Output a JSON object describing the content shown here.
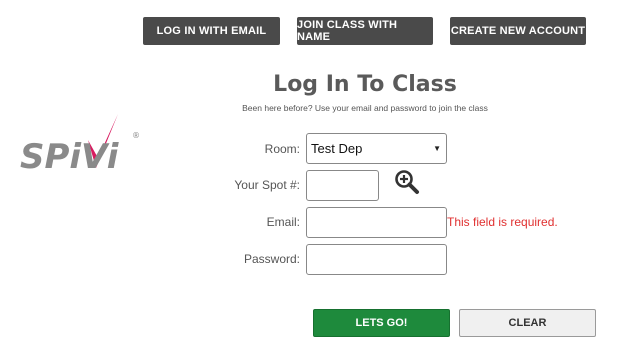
{
  "nav": {
    "login_email_label": "LOG IN WITH EMAIL",
    "join_name_label": "JOIN CLASS WITH NAME",
    "create_account_label": "CREATE NEW ACCOUNT"
  },
  "brand": {
    "logo_text": "SPiVi",
    "registered_mark": "®",
    "accent_color": "#d81b60",
    "logo_color": "#8a8a8a"
  },
  "form": {
    "title": "Log In To Class",
    "subtitle": "Been here before? Use your email and password to join the class",
    "room_label": "Room:",
    "room_value": "Test Dep",
    "spot_label": "Your Spot #:",
    "spot_value": "",
    "email_label": "Email:",
    "email_value": "",
    "email_error": "This field is required.",
    "password_label": "Password:",
    "password_value": ""
  },
  "actions": {
    "go_label": "LETS GO!",
    "clear_label": "CLEAR"
  },
  "colors": {
    "nav_bg": "#4a4a4a",
    "go_bg": "#1e8a3c",
    "error": "#e03030"
  },
  "icons": {
    "zoom": "zoom-in-icon",
    "caret": "caret-down-icon"
  }
}
